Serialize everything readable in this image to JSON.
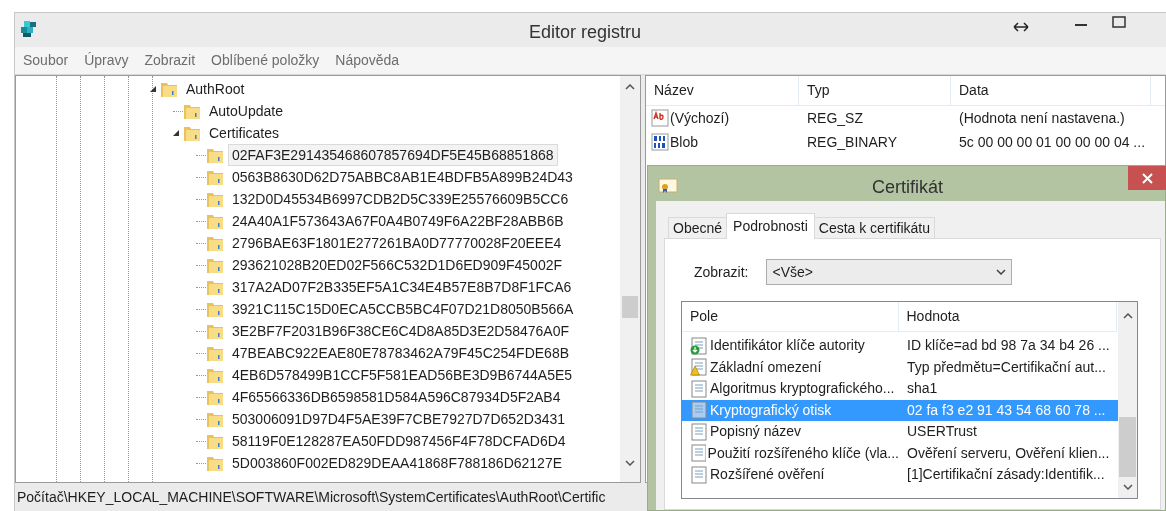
{
  "window": {
    "title": "Editor registru"
  },
  "menu": [
    "Soubor",
    "Úpravy",
    "Zobrazit",
    "Oblíbené položky",
    "Nápověda"
  ],
  "tree": [
    {
      "label": "AuthRoot",
      "expanded": true,
      "selected": false,
      "children": [
        {
          "label": "AutoUpdate",
          "selected": false
        },
        {
          "label": "Certificates",
          "expanded": true,
          "selected": false,
          "children": [
            {
              "label": "02FAF3E291435468607857694DF5E45B68851868",
              "selected": true
            },
            {
              "label": "0563B8630D62D75ABBC8AB1E4BDFB5A899B24D43",
              "selected": false
            },
            {
              "label": "132D0D45534B6997CDB2D5C339E25576609B5CC6",
              "selected": false
            },
            {
              "label": "24A40A1F573643A67F0A4B0749F6A22BF28ABB6B",
              "selected": false
            },
            {
              "label": "2796BAE63F1801E277261BA0D77770028F20EEE4",
              "selected": false
            },
            {
              "label": "293621028B20ED02F566C532D1D6ED909F45002F",
              "selected": false
            },
            {
              "label": "317A2AD07F2B335EF5A1C34E4B57E8B7D8F1FCA6",
              "selected": false
            },
            {
              "label": "3921C115C15D0ECA5CCB5BC4F07D21D8050B566A",
              "selected": false
            },
            {
              "label": "3E2BF7F2031B96F38CE6C4D8A85D3E2D58476A0F",
              "selected": false
            },
            {
              "label": "47BEABC922EAE80E78783462A79F45C254FDE68B",
              "selected": false
            },
            {
              "label": "4EB6D578499B1CCF5F581EAD56BE3D9B6744A5E5",
              "selected": false
            },
            {
              "label": "4F65566336DB6598581D584A596C87934D5F2AB4",
              "selected": false
            },
            {
              "label": "503006091D97D4F5AE39F7CBE7927D7D652D3431",
              "selected": false
            },
            {
              "label": "58119F0E128287EA50FDD987456F4F78DCFAD6D4",
              "selected": false
            },
            {
              "label": "5D003860F002ED829DEAA41868F788186D62127E",
              "selected": false
            }
          ]
        }
      ]
    }
  ],
  "values": {
    "columns": [
      "Název",
      "Typ",
      "Data"
    ],
    "rows": [
      {
        "kind": "string",
        "name": "(Výchozí)",
        "type": "REG_SZ",
        "data": "(Hodnota není nastavena.)"
      },
      {
        "kind": "binary",
        "name": "Blob",
        "type": "REG_BINARY",
        "data": "5c 00 00 00 01 00 00 00 04 ..."
      }
    ]
  },
  "status_bar": "Počítač\\HKEY_LOCAL_MACHINE\\SOFTWARE\\Microsoft\\SystemCertificates\\AuthRoot\\Certific",
  "dialog": {
    "title": "Certifikát",
    "tabs": [
      {
        "label": "Obecné",
        "selected": false
      },
      {
        "label": "Podrobnosti",
        "selected": true
      },
      {
        "label": "Cesta k certifikátu",
        "selected": false
      }
    ],
    "show_label": "Zobrazit:",
    "show_value": "<Vše>",
    "columns": [
      "Pole",
      "Hodnota"
    ],
    "fields": [
      {
        "kind": "download",
        "field": "Identifikátor klíče autority",
        "value": "ID klíče=ad bd 98 7a 34 b4 26 ...",
        "selected": false
      },
      {
        "kind": "warning",
        "field": "Základní omezení",
        "value": "Typ předmětu=Certifikační aut...",
        "selected": false
      },
      {
        "kind": "plain",
        "field": "Algoritmus kryptografického...",
        "value": "sha1",
        "selected": false
      },
      {
        "kind": "plain",
        "field": "Kryptografický otisk",
        "value": "02 fa f3 e2 91 43 54 68 60 78 ...",
        "selected": true
      },
      {
        "kind": "plain",
        "field": "Popisný název",
        "value": "USERTrust",
        "selected": false
      },
      {
        "kind": "plain",
        "field": "Použití rozšířeného klíče (vla...",
        "value": "Ověření serveru, Ověření klien...",
        "selected": false
      },
      {
        "kind": "plain",
        "field": "Rozšířené ověření",
        "value": "[1]Certifikační zásady:Identifik...",
        "selected": false
      }
    ]
  }
}
